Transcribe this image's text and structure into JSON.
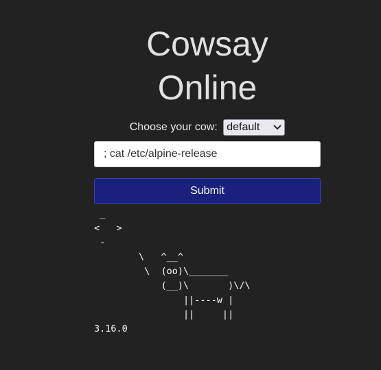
{
  "page": {
    "title_line1": "Cowsay",
    "title_line2": "Online"
  },
  "form": {
    "choose_label": "Choose your cow:",
    "cow_select": {
      "selected": "default"
    },
    "command_input": {
      "value": "; cat /etc/alpine-release"
    },
    "submit_label": "Submit"
  },
  "output": {
    "text": " _\n<   >\n -\n        \\   ^__^\n         \\  (oo)\\_______\n            (__)\\       )\\/\\\n                ||----w |\n                ||     ||\n3.16.0"
  },
  "colors": {
    "background": "#222222",
    "title": "#e1e1e1",
    "submit_bg": "#19217c",
    "input_bg": "#ffffff"
  },
  "icons": {
    "select_arrow": "chevron-down-icon"
  }
}
